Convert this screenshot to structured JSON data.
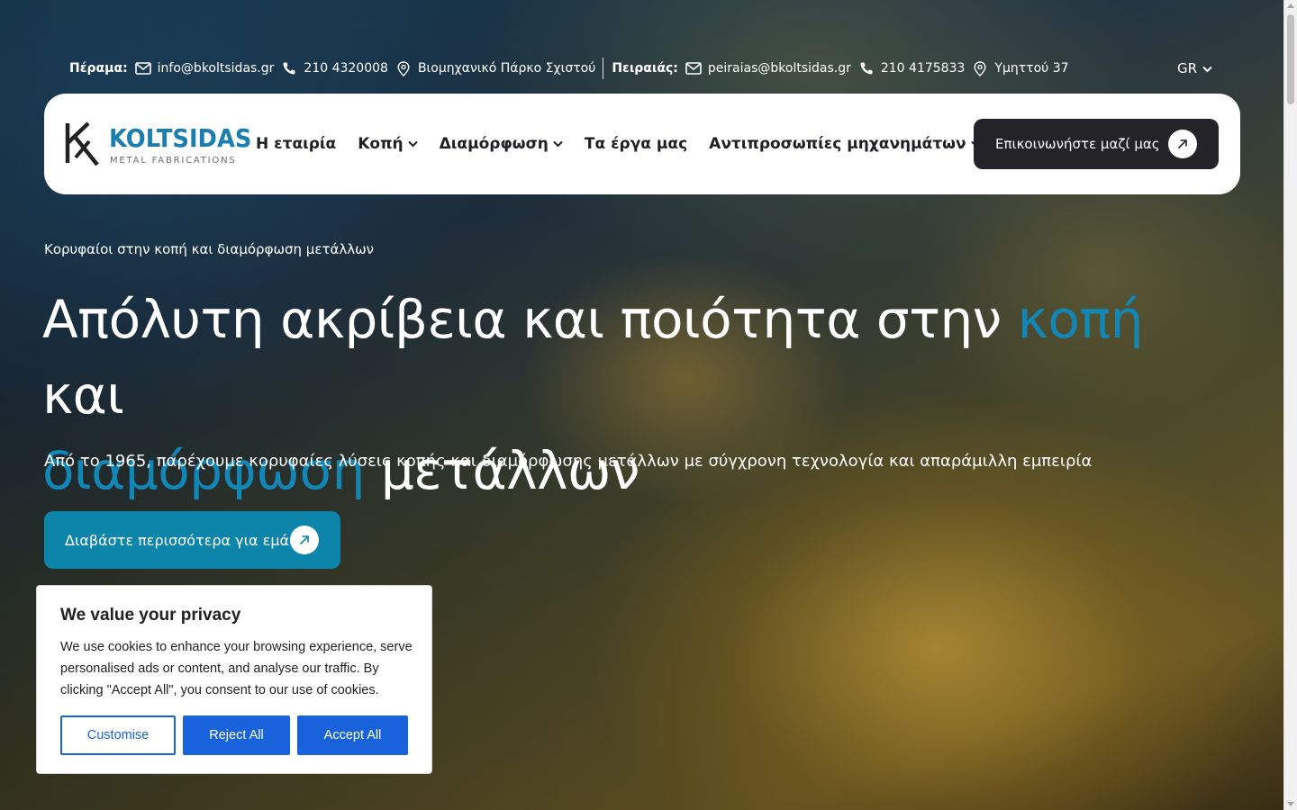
{
  "topbar": {
    "perama": {
      "label": "Πέραμα:",
      "email": "info@bkoltsidas.gr",
      "phone": "210 4320008",
      "address": "Βιομηχανικό Πάρκο Σχιστού"
    },
    "piraeus": {
      "label": "Πειραιάς:",
      "email": "peiraias@bkoltsidas.gr",
      "phone": "210 4175833",
      "address": "Υμηττού 37"
    },
    "language": "GR"
  },
  "nav": {
    "logo": {
      "brand": "KOLTSIDAS",
      "tagline": "METAL FABRICATIONS"
    },
    "items": [
      {
        "label": "Η εταιρία",
        "dropdown": false
      },
      {
        "label": "Κοπή",
        "dropdown": true
      },
      {
        "label": "Διαμόρφωση",
        "dropdown": true
      },
      {
        "label": "Τα έργα μας",
        "dropdown": false
      },
      {
        "label": "Αντιπροσωπίες μηχανημάτων",
        "dropdown": true
      }
    ],
    "cta": "Επικοινωνήστε μαζί μας"
  },
  "hero": {
    "eyebrow": "Κορυφαίοι στην κοπή και διαμόρφωση μετάλλων",
    "headline": {
      "part1": "Απόλυτη ακρίβεια και ποιότητα στην ",
      "accent1": "κοπή",
      "part2": " και ",
      "accent2": "διαμόρφωση",
      "part3": " μετάλλων"
    },
    "lead": "Από το 1965, παρέχουμε κορυφαίες λύσεις κοπής και διαμόρφωσης μετάλλων με σύγχρονη τεχνολογία και απαράμιλλη εμπειρία",
    "button": "Διαβάστε περισσότερα για εμάς"
  },
  "cookie": {
    "title": "We value your privacy",
    "text": "We use cookies to enhance your browsing experience, serve personalised ads or content, and analyse our traffic. By clicking \"Accept All\", you consent to our use of cookies.",
    "customise": "Customise",
    "reject": "Reject All",
    "accept": "Accept All"
  },
  "colors": {
    "accent": "#1287b5",
    "button_teal": "#0d84a9",
    "cta_dark": "#25232a",
    "cookie_blue": "#1863dc"
  }
}
